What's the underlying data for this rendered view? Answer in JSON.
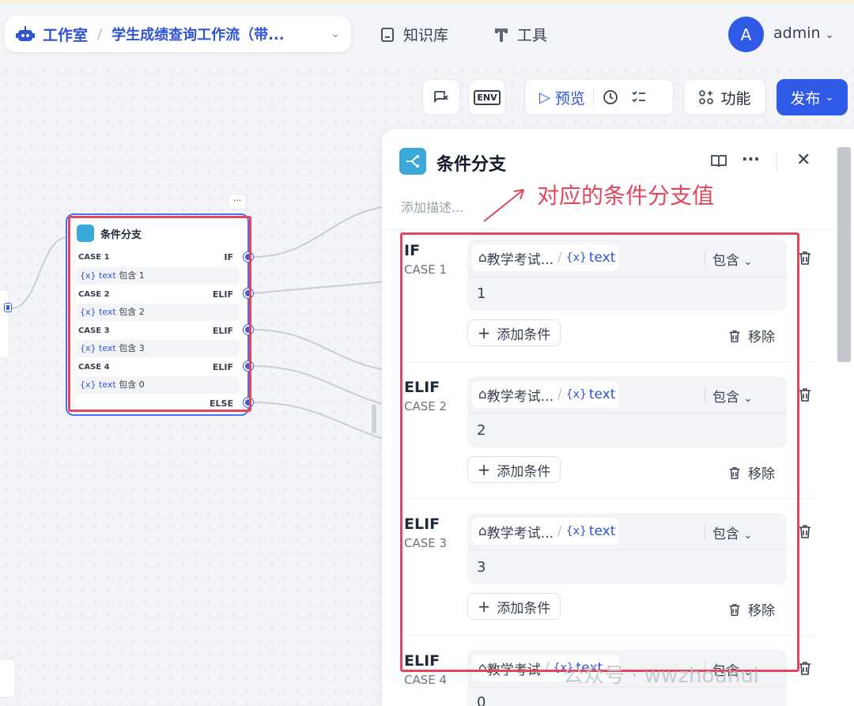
{
  "nav": {
    "studio": "工作室",
    "separator": "/",
    "workflow": "学生成绩查询工作流（带...",
    "knowledge": "知识库",
    "tools": "工具",
    "avatar_letter": "A",
    "user": "admin"
  },
  "toolbar": {
    "env_label": "ENV",
    "preview": "预览",
    "features": "功能",
    "publish": "发布"
  },
  "node": {
    "more": "···",
    "title": "条件分支",
    "cases": [
      {
        "case": "CASE 1",
        "keyword": "IF",
        "var": "text",
        "op": "包含",
        "value": "1"
      },
      {
        "case": "CASE 2",
        "keyword": "ELIF",
        "var": "text",
        "op": "包含",
        "value": "2"
      },
      {
        "case": "CASE 3",
        "keyword": "ELIF",
        "var": "text",
        "op": "包含",
        "value": "3"
      },
      {
        "case": "CASE 4",
        "keyword": "ELIF",
        "var": "text",
        "op": "包含",
        "value": "0"
      }
    ],
    "else": "ELSE",
    "var_prefix": "{x}"
  },
  "panel": {
    "title": "条件分支",
    "description_placeholder": "添加描述...",
    "annotation": "对应的条件分支值",
    "cases": [
      {
        "keyword": "IF",
        "case": "CASE 1",
        "source": "教学考试...",
        "var": "text",
        "op": "包含",
        "value": "1"
      },
      {
        "keyword": "ELIF",
        "case": "CASE 2",
        "source": "教学考试...",
        "var": "text",
        "op": "包含",
        "value": "2"
      },
      {
        "keyword": "ELIF",
        "case": "CASE 3",
        "source": "教学考试...",
        "var": "text",
        "op": "包含",
        "value": "3"
      },
      {
        "keyword": "ELIF",
        "case": "CASE 4",
        "source": "教学考试",
        "var": "text",
        "op": "包含",
        "value": "0"
      }
    ],
    "add_condition": "添加条件",
    "remove": "移除",
    "var_prefix": "{x}"
  },
  "watermark": "公众号 · wwzhouhui",
  "colors": {
    "accent": "#2f5ae8",
    "annotation": "#e3475c",
    "node_icon": "#3aa8d8"
  }
}
